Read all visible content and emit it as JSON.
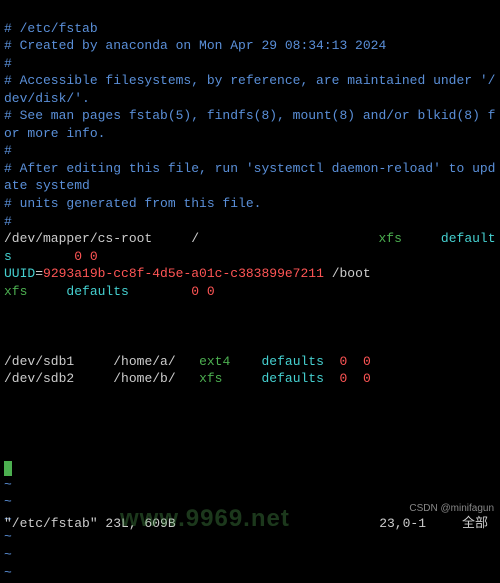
{
  "comments": {
    "c1": "# /etc/fstab",
    "c2": "# Created by anaconda on Mon Apr 29 08:34:13 2024",
    "c3": "#",
    "c4": "# Accessible filesystems, by reference, are maintained under '/dev/disk/'.",
    "c5": "# See man pages fstab(5), findfs(8), mount(8) and/or blkid(8) for more info.",
    "c6": "#",
    "c7": "# After editing this file, run 'systemctl daemon-reload' to update systemd",
    "c8": "# units generated from this file.",
    "c9": "#"
  },
  "entry1": {
    "device": "/dev/mapper/cs-root",
    "mount": "/",
    "fs": "xfs",
    "opts": "defaults",
    "n1": "0",
    "n2": "0"
  },
  "entry2": {
    "label": "UUID",
    "eq": "=",
    "uuid": "9293a19b-cc8f-4d5e-a01c-c383899e7211",
    "mount": "/boot",
    "fs": "xfs",
    "opts": "defaults",
    "n1": "0",
    "n2": "0"
  },
  "entry3": {
    "device": "/dev/sdb1",
    "mount": "/home/a/",
    "fs": "ext4",
    "opts": "defaults",
    "n1": "0",
    "n2": "0"
  },
  "entry4": {
    "device": "/dev/sdb2",
    "mount": "/home/b/",
    "fs": "xfs",
    "opts": "defaults",
    "n1": "0",
    "n2": "0"
  },
  "tilde": "~",
  "status": {
    "file": "\"/etc/fstab\" 23L, 609B",
    "pos": "23,0-1",
    "pct": "全部"
  },
  "watermark": {
    "url": "www.9969.net",
    "credit": "CSDN @minifagun"
  }
}
